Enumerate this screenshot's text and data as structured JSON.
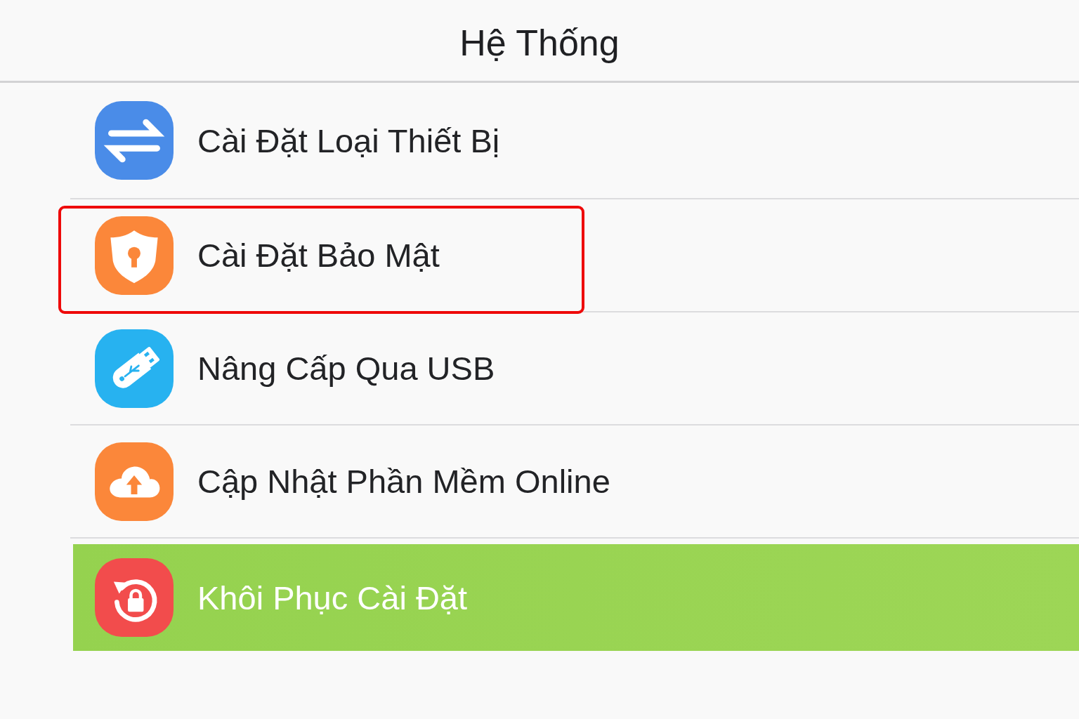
{
  "header": {
    "title": "Hệ Thống"
  },
  "items": [
    {
      "label": "Cài Đặt Loại Thiết Bị",
      "kind": "swap",
      "color": "#4a8ce8",
      "selected": false,
      "highlighted": false
    },
    {
      "label": "Cài Đặt Bảo Mật",
      "kind": "shield",
      "color": "#fb873a",
      "selected": false,
      "highlighted": true
    },
    {
      "label": "Nâng Cấp Qua USB",
      "kind": "usb",
      "color": "#27b2f0",
      "selected": false,
      "highlighted": false
    },
    {
      "label": "Cập Nhật Phần Mềm Online",
      "kind": "upload",
      "color": "#fb873a",
      "selected": false,
      "highlighted": false
    },
    {
      "label": "Khôi Phục Cài Đặt",
      "kind": "restore",
      "color": "#f24c4c",
      "selected": true,
      "highlighted": false
    }
  ]
}
